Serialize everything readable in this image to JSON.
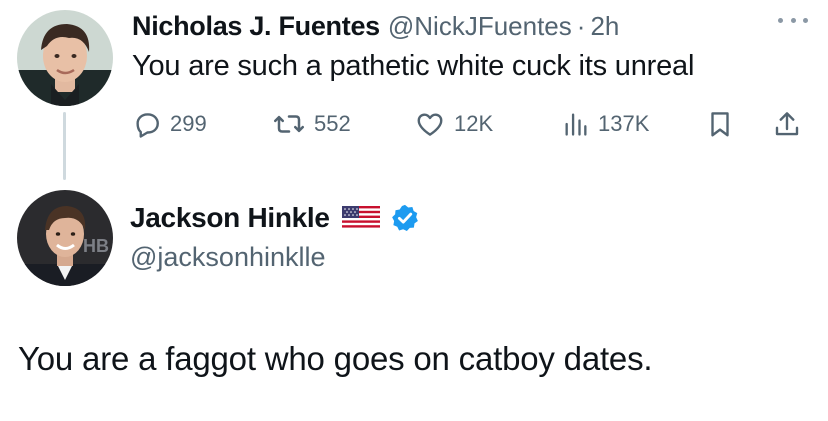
{
  "tweet": {
    "author_name": "Nicholas J. Fuentes",
    "handle": "@NickJFuentes",
    "separator": "·",
    "time": "2h",
    "text": "You are such a pathetic white cuck its unreal",
    "avatar_icon": "profile-photo",
    "more_icon": "more-dots-icon",
    "actions": {
      "replies": "299",
      "reposts": "552",
      "likes": "12K",
      "views": "137K"
    }
  },
  "reply": {
    "author_name": "Jackson Hinkle",
    "handle": "@jacksonhinklle",
    "badges": [
      "us-flag-emoji",
      "verified-badge-icon"
    ],
    "avatar_icon": "profile-photo",
    "text": "You are a faggot who goes on catboy dates."
  },
  "colors": {
    "text": "#0f1419",
    "secondary": "#536471",
    "verified": "#1d9bf0",
    "thread_line": "#cfd9de"
  }
}
